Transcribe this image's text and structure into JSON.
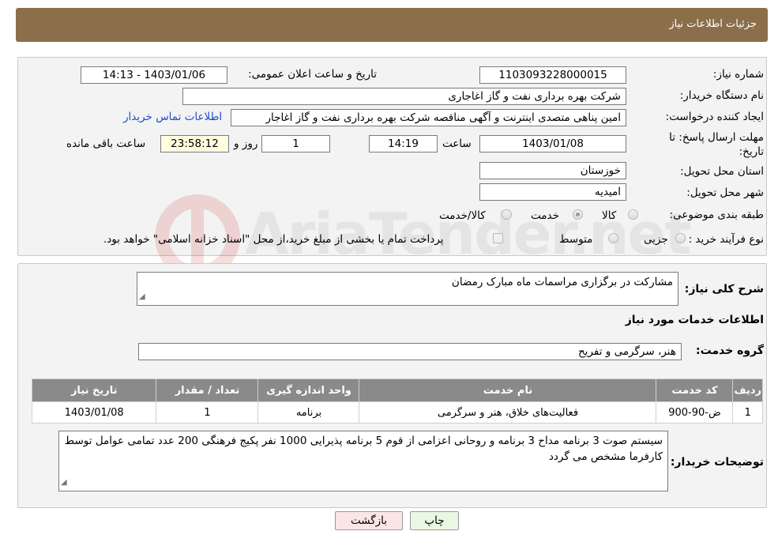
{
  "header": {
    "title": "جزئیات اطلاعات نیاز"
  },
  "form": {
    "need_number": {
      "label": "شماره نیاز:",
      "value": "1103093228000015"
    },
    "announce_datetime": {
      "label": "تاریخ و ساعت اعلان عمومی:",
      "value": "1403/01/06 - 14:13"
    },
    "buyer_org": {
      "label": "نام دستگاه خریدار:",
      "value": "شرکت بهره برداری نفت و گاز اغاجاری"
    },
    "requester": {
      "label": "ایجاد کننده درخواست:",
      "value": "امین پناهی متصدی اینترنت و آگهی مناقصه شرکت بهره برداری نفت و گاز اغاجار",
      "contact_link": "اطلاعات تماس خریدار"
    },
    "deadline": {
      "label": "مهلت ارسال پاسخ: تا تاریخ:",
      "date": "1403/01/08",
      "time_label": "ساعت",
      "time": "14:19",
      "days": "1",
      "days_label": "روز و",
      "remaining": "23:58:12",
      "remaining_label": "ساعت باقی مانده"
    },
    "province": {
      "label": "استان محل تحویل:",
      "value": "خوزستان"
    },
    "city": {
      "label": "شهر محل تحویل:",
      "value": "امیدیه"
    },
    "category": {
      "label": "طبقه بندی موضوعی:",
      "options": [
        "کالا",
        "خدمت",
        "کالا/خدمت"
      ],
      "selected": "خدمت"
    },
    "purchase_type": {
      "label": "نوع فرآیند خرید :",
      "options": [
        "جزیی",
        "متوسط"
      ],
      "note": "پرداخت تمام یا بخشی از مبلغ خرید،از محل \"اسناد خزانه اسلامی\" خواهد بود."
    }
  },
  "details": {
    "summary_label": "شرح کلی نیاز:",
    "summary": "مشارکت در برگزاری مراسمات ماه مبارک رمضان",
    "services_heading": "اطلاعات خدمات مورد نیاز",
    "service_group_label": "گروه خدمت:",
    "service_group": "هنر، سرگرمی و تفریح",
    "table": {
      "headers": [
        "ردیف",
        "کد خدمت",
        "نام خدمت",
        "واحد اندازه گیری",
        "تعداد / مقدار",
        "تاریخ نیاز"
      ],
      "rows": [
        [
          "1",
          "ض-90-900",
          "فعالیت‌های خلاق، هنر و سرگرمی",
          "برنامه",
          "1",
          "1403/01/08"
        ]
      ]
    },
    "buyer_notes_label": "توضیحات خریدار:",
    "buyer_notes": "سیستم صوت 3 برنامه مداح 3 برنامه و روحانی اعزامی از قوم 5 برنامه  پذیرایی 1000 نفر پکیج فرهنگی 200 عدد تمامی عوامل توسط کارفرما مشخص می گردد"
  },
  "buttons": {
    "print": "چاپ",
    "back": "بازگشت"
  },
  "watermark": "AriaTender.net"
}
